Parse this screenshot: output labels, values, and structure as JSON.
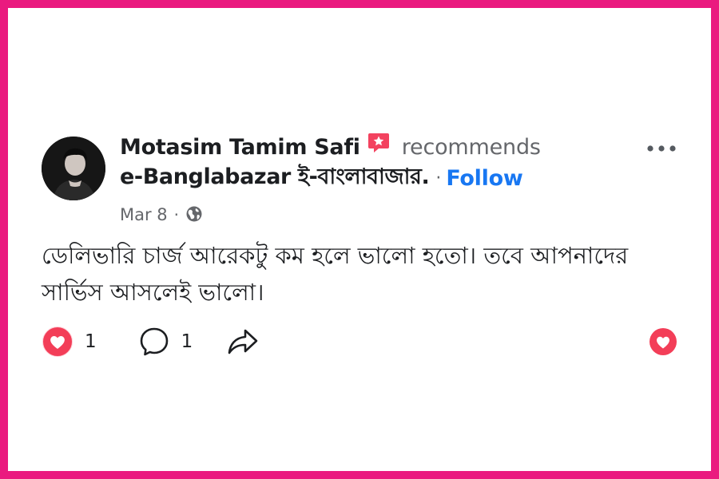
{
  "post": {
    "author": "Motasim Tamim Safi",
    "recommend_text": "recommends",
    "page_name": "e-Banglabazar ই-বাংলাবাজার.",
    "separator": "·",
    "follow_label": "Follow",
    "date": "Mar 8",
    "meta_separator": "·",
    "privacy_icon": "globe-icon",
    "body": "ডেলিভারি চার্জ আরেকটু কম হলে ভালো হতো। তবে আপনাদের সার্ভিস আসলেই ভালো।"
  },
  "actions": {
    "love_count": "1",
    "comment_count": "1",
    "love_icon": "heart-reaction-icon",
    "comment_icon": "comment-icon",
    "share_icon": "share-icon",
    "react_icon": "heart-react-button-icon"
  },
  "colors": {
    "frame": "#ea1a7f",
    "follow": "#1877f2",
    "love": "#f33e58",
    "recommend_badge": "#f3425f"
  }
}
